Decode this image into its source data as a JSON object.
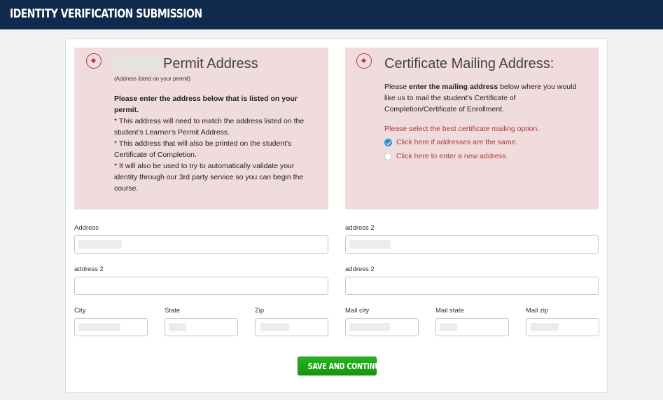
{
  "header": {
    "title": "IDENTITY VERIFICATION SUBMISSION"
  },
  "permit_panel": {
    "title": "Permit Address",
    "subtitle": "(Address listed on your permit)",
    "intro_bold": "Please enter the address below that is listed on your permit.",
    "bullet1": "* This address will need to match the address listed on the student's Learner's Permit Address.",
    "bullet2": "* This address that will also be printed on the student's Certificate of Completion.",
    "bullet3": "* It will also be used to try to automatically validate your identity through our 3rd party service so you can begin the course."
  },
  "mailing_panel": {
    "title": "Certificate Mailing Address:",
    "intro_prefix": "Please ",
    "intro_bold": "enter the mailing address",
    "intro_rest": " below where you would like us to mail the student's Certificate of Completion/Certificate of Enrollment.",
    "options_heading": "Please select the best certificate mailing option.",
    "option_same": "Click here if addresses are the same.",
    "option_new": "Click here to enter a new address.",
    "selected_option": "same"
  },
  "form": {
    "left": {
      "address_label": "Address",
      "address2_label": "address 2",
      "city_label": "City",
      "state_label": "State",
      "zip_label": "Zip"
    },
    "right": {
      "address_label": "address 2",
      "address2_label": "address 2",
      "city_label": "Mail city",
      "state_label": "Mail state",
      "zip_label": "Mail zip"
    }
  },
  "actions": {
    "save_label": "SAVE AND CONTINUE"
  },
  "colors": {
    "header_bg": "#0f2a4d",
    "panel_bg": "#f0dcdc",
    "accent_red": "#b03a3a",
    "button_green": "#1fa517",
    "radio_blue": "#2d8fd4"
  },
  "icons": {
    "panel_icon": "circle-dot-icon",
    "check": "checkmark-icon"
  }
}
